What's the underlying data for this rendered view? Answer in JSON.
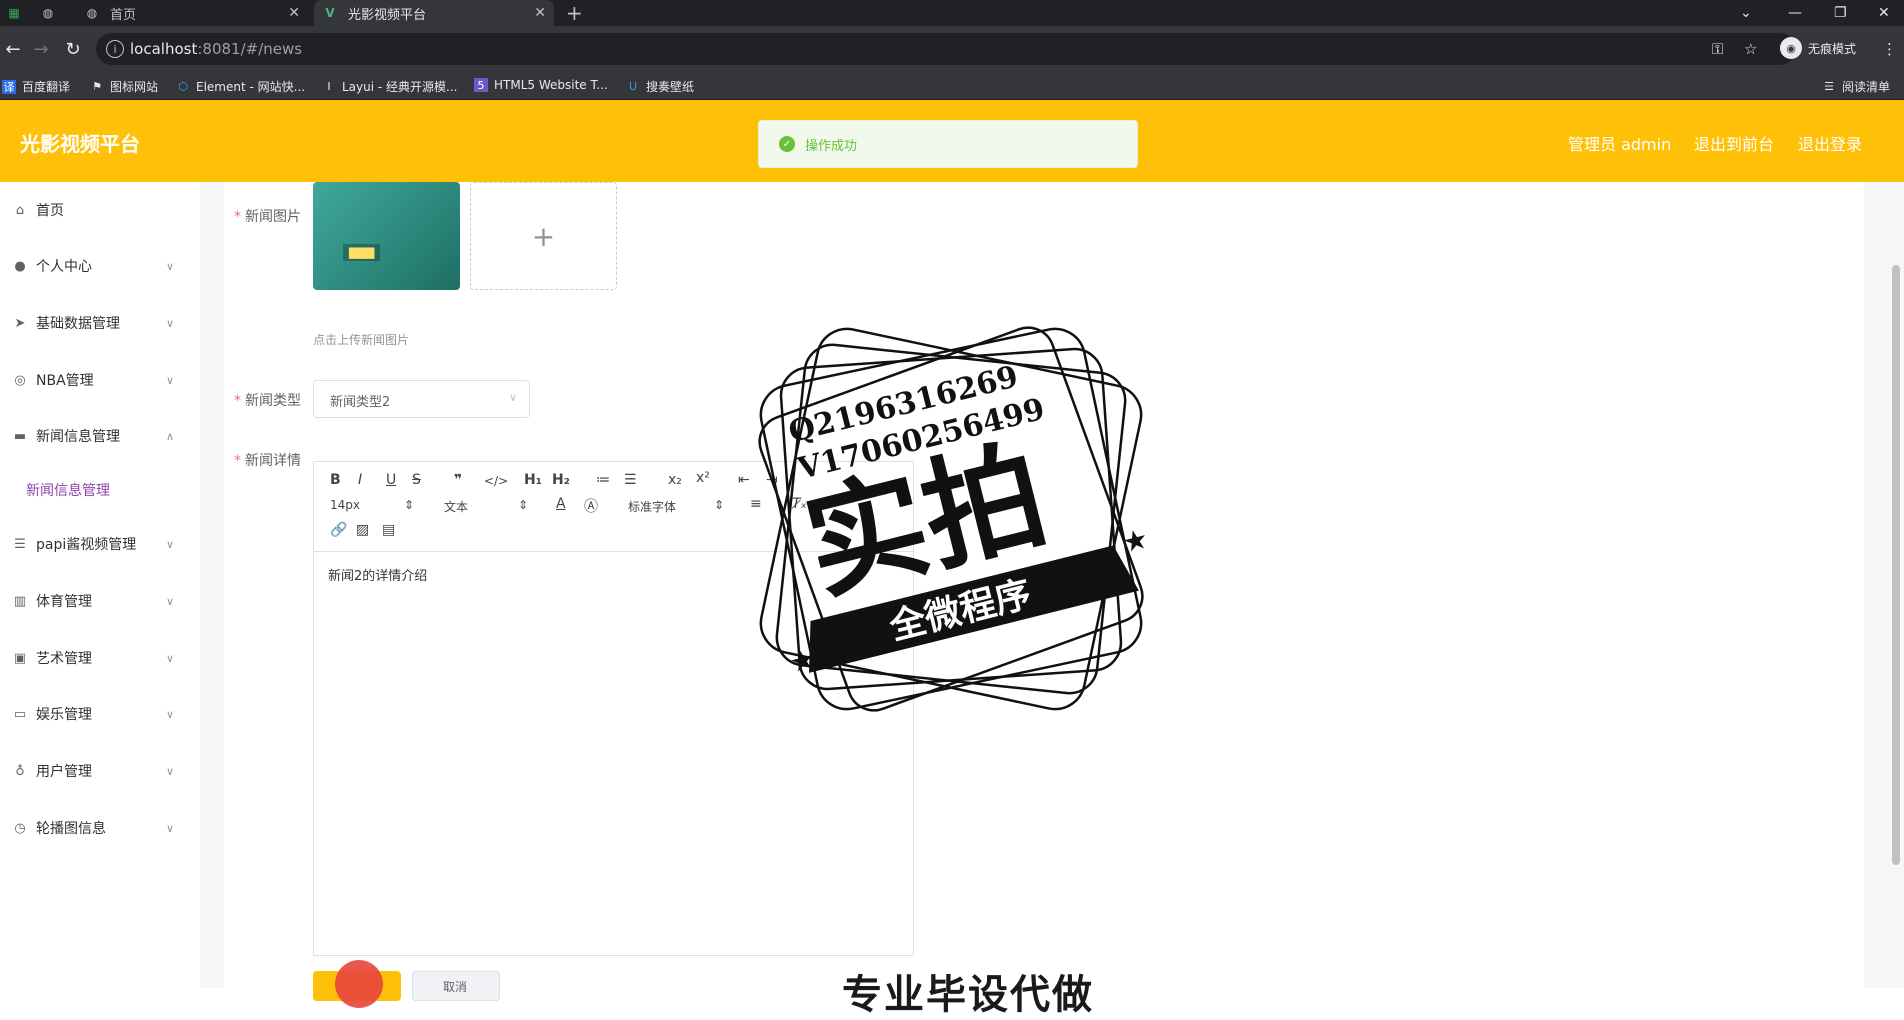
{
  "browser": {
    "tabs": [
      {
        "title": "首页",
        "active": false
      },
      {
        "title": "光影视频平台",
        "active": true
      }
    ],
    "address": {
      "host": "localhost",
      "path": ":8081/#/news"
    },
    "incognito_label": "无痕模式",
    "bookmarks": [
      "百度翻译",
      "图标网站",
      "Element - 网站快...",
      "Layui - 经典开源模...",
      "HTML5 Website T...",
      "搜奏壁纸"
    ],
    "reading_list": "阅读清单"
  },
  "app": {
    "title": "光影视频平台",
    "user": "管理员 admin",
    "goto_front": "退出到前台",
    "logout": "退出登录",
    "toast": "操作成功",
    "accent": "#ffc107"
  },
  "sidebar": {
    "items": [
      {
        "label": "首页",
        "icon": "home-icon"
      },
      {
        "label": "个人中心",
        "icon": "user-icon"
      },
      {
        "label": "基础数据管理",
        "icon": "send-icon"
      },
      {
        "label": "NBA管理",
        "icon": "target-icon"
      },
      {
        "label": "新闻信息管理",
        "icon": "message-icon"
      },
      {
        "label": "papi酱视频管理",
        "icon": "list-icon"
      },
      {
        "label": "体育管理",
        "icon": "chart-icon"
      },
      {
        "label": "艺术管理",
        "icon": "clipboard-icon"
      },
      {
        "label": "娱乐管理",
        "icon": "chat-icon"
      },
      {
        "label": "用户管理",
        "icon": "mic-icon"
      },
      {
        "label": "轮播图信息",
        "icon": "compass-icon"
      }
    ],
    "active_sub": "新闻信息管理"
  },
  "form": {
    "image_label": "新闻图片",
    "image_hint": "点击上传新闻图片",
    "type_label": "新闻类型",
    "type_value": "新闻类型2",
    "detail_label": "新闻详情",
    "editor": {
      "font_size": "14px",
      "format": "文本",
      "font": "标准字体",
      "content": "新闻2的详情介绍"
    },
    "cancel_label": "取消"
  },
  "watermark": {
    "contact_q": "Q2196316269",
    "contact_v": "V17060256499",
    "big": "实拍",
    "ribbon": "全微程序",
    "bottom": "专业毕设代做"
  }
}
